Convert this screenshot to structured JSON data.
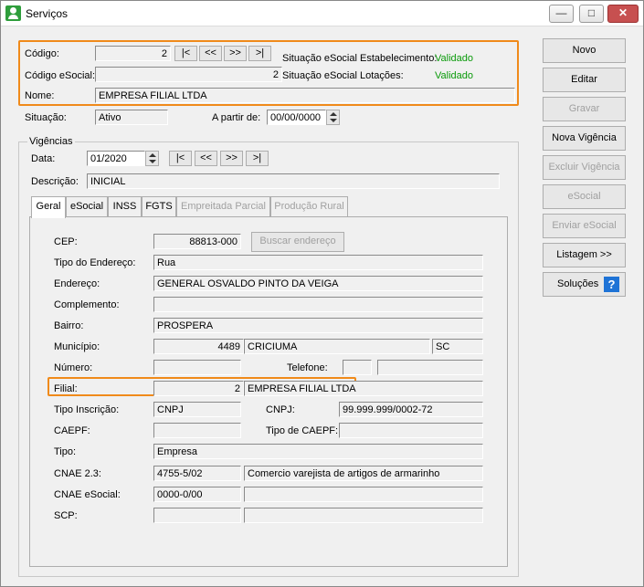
{
  "window": {
    "title": "Serviços"
  },
  "header": {
    "codigo_label": "Código:",
    "codigo_value": "2",
    "codigo_esocial_label": "Código eSocial:",
    "codigo_esocial_value": "2",
    "nome_label": "Nome:",
    "nome_value": "EMPRESA FILIAL LTDA",
    "sit_estab_label": "Situação eSocial Estabelecimento:",
    "sit_estab_value": "Validado",
    "sit_lot_label": "Situação eSocial Lotações:",
    "sit_lot_value": "Validado",
    "situacao_label": "Situação:",
    "situacao_value": "Ativo",
    "apartir_label": "A partir de:",
    "apartir_value": "00/00/0000"
  },
  "nav": {
    "first": "|<",
    "prev": "<<",
    "next": ">>",
    "last": ">|"
  },
  "vigencias": {
    "group_label": "Vigências",
    "data_label": "Data:",
    "data_value": "01/2020",
    "descricao_label": "Descrição:",
    "descricao_value": "INICIAL"
  },
  "tabs": [
    {
      "label": "Geral"
    },
    {
      "label": "eSocial"
    },
    {
      "label": "INSS"
    },
    {
      "label": "FGTS"
    },
    {
      "label": "Empreitada Parcial"
    },
    {
      "label": "Produção Rural"
    }
  ],
  "geral": {
    "cep_label": "CEP:",
    "cep_value": "88813-000",
    "buscar_endereco": "Buscar endereço",
    "tipo_end_label": "Tipo do Endereço:",
    "tipo_end_value": "Rua",
    "endereco_label": "Endereço:",
    "endereco_value": "GENERAL OSVALDO PINTO DA VEIGA",
    "complemento_label": "Complemento:",
    "complemento_value": "",
    "bairro_label": "Bairro:",
    "bairro_value": "PROSPERA",
    "municipio_label": "Município:",
    "municipio_code": "4489",
    "municipio_name": "CRICIUMA",
    "uf": "SC",
    "numero_label": "Número:",
    "numero_value": "",
    "telefone_label": "Telefone:",
    "filial_label": "Filial:",
    "filial_code": "2",
    "filial_name": "EMPRESA FILIAL LTDA",
    "tipo_insc_label": "Tipo Inscrição:",
    "tipo_insc_value": "CNPJ",
    "cnpj_label": "CNPJ:",
    "cnpj_value": "99.999.999/0002-72",
    "caepf_label": "CAEPF:",
    "tipo_caepf_label": "Tipo de CAEPF:",
    "tipo_label": "Tipo:",
    "tipo_value": "Empresa",
    "cnae_label": "CNAE 2.3:",
    "cnae_code": "4755-5/02",
    "cnae_desc": "Comercio varejista de artigos de armarinho",
    "cnae_esocial_label": "CNAE eSocial:",
    "cnae_esocial_value": "0000-0/00",
    "scp_label": "SCP:"
  },
  "sidebar": {
    "novo": "Novo",
    "editar": "Editar",
    "gravar": "Gravar",
    "nova_vigencia": "Nova Vigência",
    "excluir_vigencia": "Excluir Vigência",
    "esocial": "eSocial",
    "enviar_esocial": "Enviar eSocial",
    "listagem": "Listagem >>",
    "solucoes": "Soluções",
    "help": "?"
  },
  "colors": {
    "highlight": "#f08a1a",
    "validated": "#0a9a0a",
    "help": "#1e73d6"
  },
  "icons": [
    "app-icon",
    "minimize-icon",
    "maximize-icon",
    "close-icon",
    "help-icon"
  ]
}
